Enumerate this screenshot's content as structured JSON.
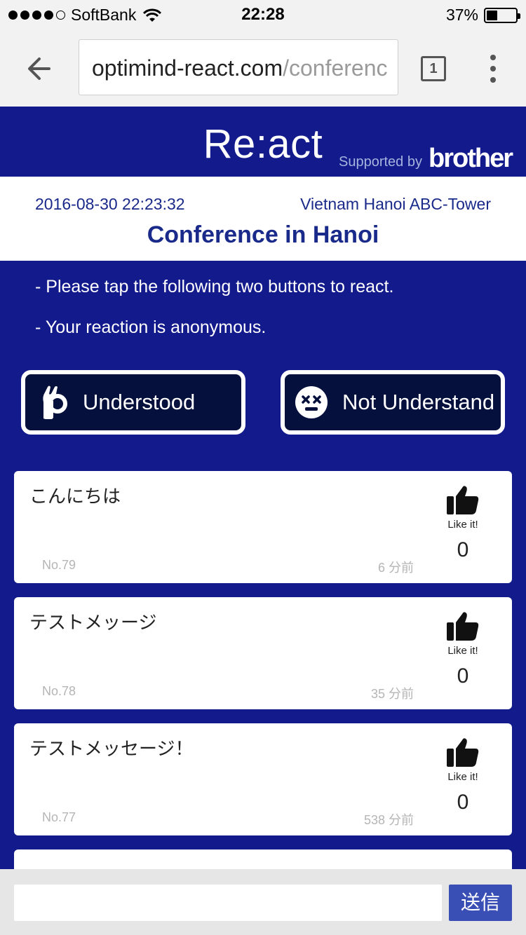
{
  "status_bar": {
    "carrier": "SoftBank",
    "time": "22:28",
    "battery": "37%",
    "battery_level": 0.37
  },
  "browser": {
    "url_host": "optimind-react.com",
    "url_path": "/conferenc",
    "tab_count": "1"
  },
  "header": {
    "logo": "Re:act",
    "supported_by": "Supported by",
    "brand": "brother"
  },
  "event": {
    "datetime": "2016-08-30 22:23:32",
    "location": "Vietnam Hanoi ABC-Tower",
    "title": "Conference in Hanoi"
  },
  "instructions": [
    "- Please tap the following two buttons to react.",
    "- Your reaction is anonymous."
  ],
  "reactions": {
    "understood": "Understood",
    "not_understand": "Not Understand"
  },
  "messages": [
    {
      "text": "こんにちは",
      "number": "No.79",
      "time": "6 分前",
      "like_label": "Like it!",
      "likes": "0"
    },
    {
      "text": "テストメッージ",
      "number": "No.78",
      "time": "35 分前",
      "like_label": "Like it!",
      "likes": "0"
    },
    {
      "text": "テストメッセージ！",
      "number": "No.77",
      "time": "538 分前",
      "like_label": "Like it!",
      "likes": "0"
    }
  ],
  "composer": {
    "placeholder": "",
    "send_label": "送信"
  },
  "colors": {
    "primary": "#121a8c",
    "button_bg": "#06103c",
    "send": "#3a4fb5",
    "title_text": "#1a2a8a"
  }
}
